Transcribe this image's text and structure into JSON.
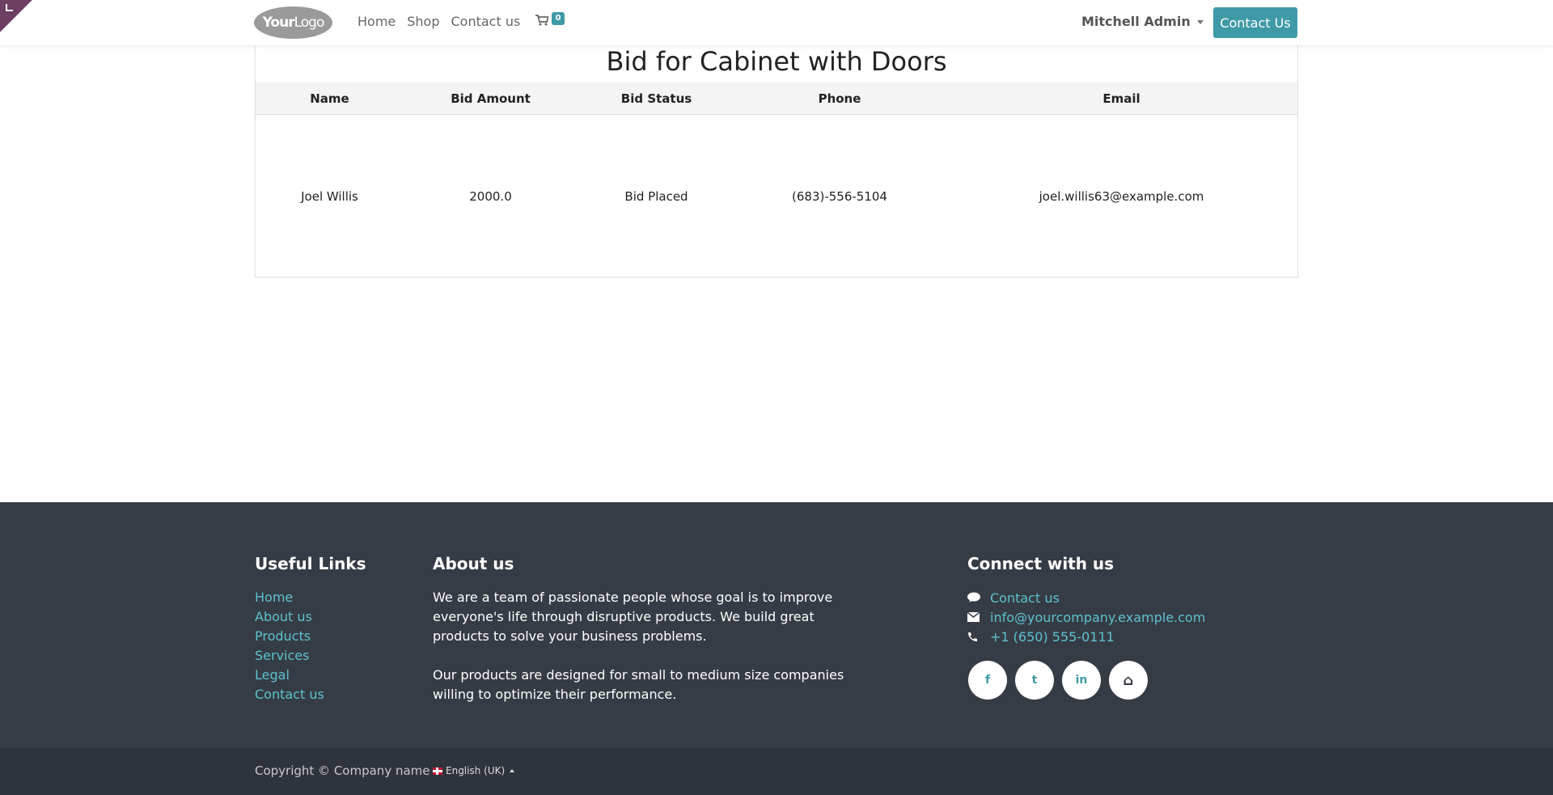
{
  "header": {
    "logo_text_bold": "Your",
    "logo_text": "Logo",
    "nav": [
      "Home",
      "Shop",
      "Contact us"
    ],
    "cart_count": "0",
    "user": "Mitchell Admin",
    "contact_button": "Contact Us"
  },
  "main": {
    "title": "Bid for Cabinet with Doors",
    "columns": [
      "Name",
      "Bid Amount",
      "Bid Status",
      "Phone",
      "Email"
    ],
    "rows": [
      [
        "Joel Willis",
        "2000.0",
        "Bid Placed",
        "(683)-556-5104",
        "joel.willis63@example.com"
      ]
    ]
  },
  "footer": {
    "useful_links_title": "Useful Links",
    "useful_links": [
      "Home",
      "About us",
      "Products",
      "Services",
      "Legal",
      "Contact us"
    ],
    "about_title": "About us",
    "about_p1": "We are a team of passionate people whose goal is to improve everyone's life through disruptive products. We build great products to solve your business problems.",
    "about_p2": "Our products are designed for small to medium size companies willing to optimize their performance.",
    "connect_title": "Connect with us",
    "connect_contact": "Contact us",
    "connect_email": "info@yourcompany.example.com",
    "connect_phone": "+1 (650) 555-0111",
    "socials": [
      {
        "icon": "facebook-icon",
        "glyph": "f"
      },
      {
        "icon": "twitter-icon",
        "glyph": "t"
      },
      {
        "icon": "linkedin-icon",
        "glyph": "in"
      },
      {
        "icon": "home-icon",
        "glyph": "⌂"
      }
    ]
  },
  "copyright": {
    "text": "Copyright © Company name",
    "language": "English (UK)"
  },
  "colors": {
    "accent": "#3e9aa6",
    "link": "#5bc3cf",
    "footer_bg": "#363c45",
    "copyright_bg": "#2f343c"
  }
}
